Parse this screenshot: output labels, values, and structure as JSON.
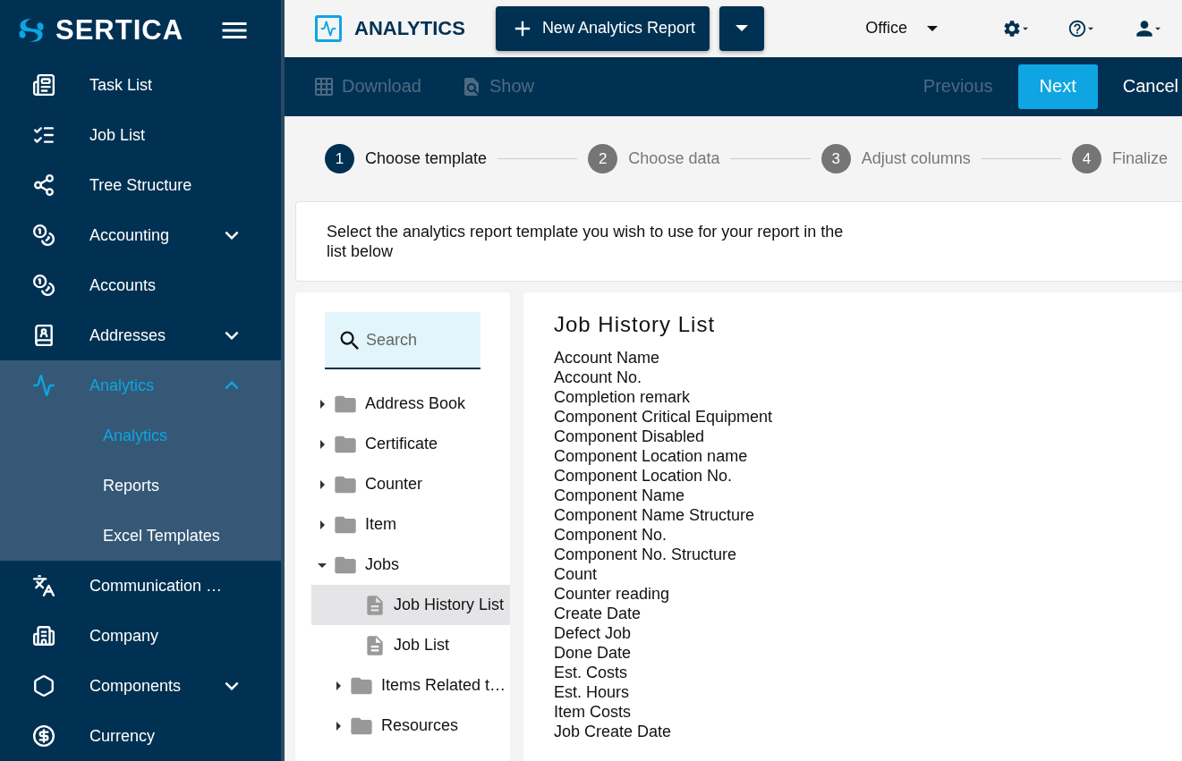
{
  "sidebar": {
    "logo": "SERTICA",
    "items": [
      {
        "label": "Task List",
        "selected": false
      },
      {
        "label": "Job List",
        "selected": false
      },
      {
        "label": "Tree Structure",
        "selected": false
      },
      {
        "label": "Accounting",
        "selected": false,
        "expanded": false
      },
      {
        "label": "Accounts",
        "selected": false
      },
      {
        "label": "Addresses",
        "selected": false,
        "expanded": false
      },
      {
        "label": "Analytics",
        "selected": true,
        "expanded": true,
        "children": [
          {
            "label": "Analytics",
            "selected": true
          },
          {
            "label": "Reports",
            "selected": false
          },
          {
            "label": "Excel Templates",
            "selected": false
          }
        ]
      },
      {
        "label": "Communication …",
        "selected": false
      },
      {
        "label": "Company",
        "selected": false
      },
      {
        "label": "Components",
        "selected": false,
        "expanded": false
      },
      {
        "label": "Currency",
        "selected": false
      }
    ]
  },
  "header": {
    "title": "ANALYTICS",
    "new_button": "New Analytics Report",
    "office": "Office"
  },
  "toolbar": {
    "left": [
      {
        "label": "Download",
        "disabled": true
      },
      {
        "label": "Show",
        "disabled": true
      }
    ],
    "previous": {
      "label": "Previous",
      "disabled": true
    },
    "next": "Next",
    "cancel": "Cancel"
  },
  "steps": [
    {
      "number": "1",
      "label": "Choose template",
      "selected": true
    },
    {
      "number": "2",
      "label": "Choose data",
      "selected": false
    },
    {
      "number": "3",
      "label": "Adjust columns",
      "selected": false
    },
    {
      "number": "4",
      "label": "Finalize",
      "selected": false
    }
  ],
  "instructions": "Select the analytics report template you wish to use for your report in the list below",
  "search": {
    "placeholder": "Search"
  },
  "tree": [
    {
      "label": "Address Book",
      "kind": "folder",
      "expanded": false,
      "selected": false
    },
    {
      "label": "Certificate",
      "kind": "folder",
      "expanded": false,
      "selected": false
    },
    {
      "label": "Counter",
      "kind": "folder",
      "expanded": false,
      "selected": false
    },
    {
      "label": "Item",
      "kind": "folder",
      "expanded": false,
      "selected": false
    },
    {
      "label": "Jobs",
      "kind": "folder",
      "expanded": true,
      "selected": false,
      "children": [
        {
          "label": "Job History List",
          "kind": "file",
          "selected": true
        },
        {
          "label": "Job List",
          "kind": "file",
          "selected": false
        },
        {
          "label": "Items Related t…",
          "kind": "folder",
          "expanded": false,
          "selected": false
        },
        {
          "label": "Resources",
          "kind": "folder",
          "expanded": false,
          "selected": false
        }
      ]
    }
  ],
  "detail": {
    "title": "Job History List",
    "fields": [
      "Account Name",
      "Account No.",
      "Completion remark",
      "Component Critical Equipment",
      "Component Disabled",
      "Component Location name",
      "Component Location No.",
      "Component Name",
      "Component Name Structure",
      "Component No.",
      "Component No. Structure",
      "Count",
      "Counter reading",
      "Create Date",
      "Defect Job",
      "Done Date",
      "Est. Costs",
      "Est. Hours",
      "Item Costs",
      "Job Create Date"
    ]
  }
}
